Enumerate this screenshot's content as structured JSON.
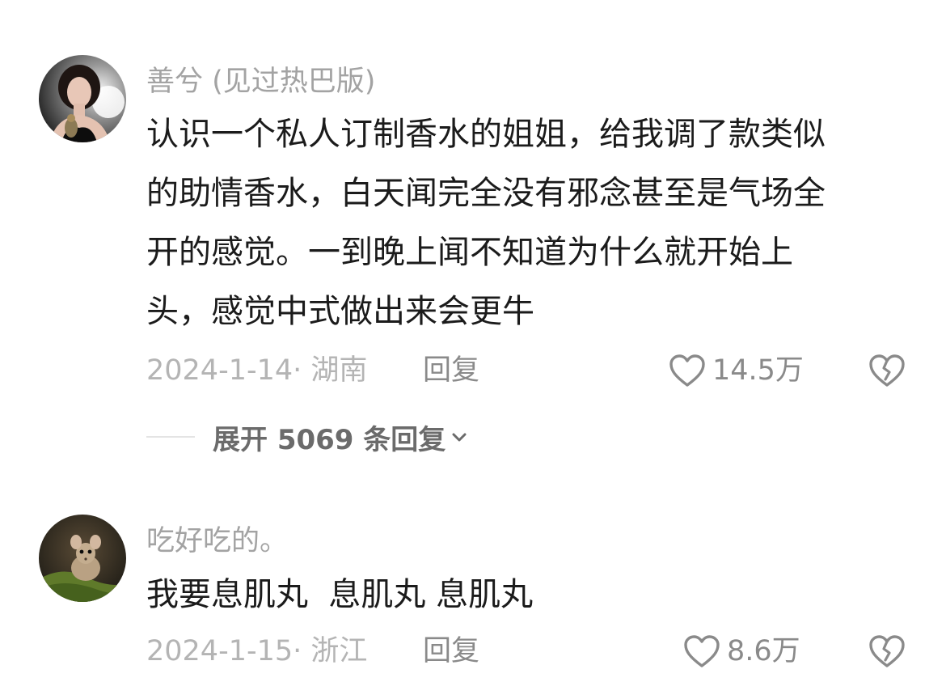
{
  "comments": [
    {
      "username": "善兮 (见过热巴版)",
      "avatar": "avatar-woman-photo",
      "text_lines": [
        "认识一个私人订制香水的姐姐，给我调了款类似",
        "的助情香水，白天闻完全没有邪念甚至是气场全",
        "开的感觉。一到晚上闻不知道为什么就开始上",
        "头，感觉中式做出来会更牛"
      ],
      "date_location": "2024-1-14· 湖南",
      "reply_label": "回复",
      "like_icon": "heart-outline-icon",
      "like_count": "14.5万",
      "dislike_icon": "broken-heart-icon",
      "expand_replies_label": "展开 5069 条回复",
      "expand_icon": "chevron-down-icon"
    },
    {
      "username": "吃好吃的。",
      "avatar": "avatar-mouse-photo",
      "text_lines": [
        "我要息肌丸  息肌丸 息肌丸"
      ],
      "date_location": "2024-1-15· 浙江",
      "reply_label": "回复",
      "like_icon": "heart-outline-icon",
      "like_count": "8.6万",
      "dislike_icon": "broken-heart-icon"
    }
  ],
  "colors": {
    "primary_text": "#1b1b1b",
    "username": "#a3a3a3",
    "meta": "#b4b4b4",
    "action": "#8a8a8a",
    "expand": "#6b6b6b"
  }
}
